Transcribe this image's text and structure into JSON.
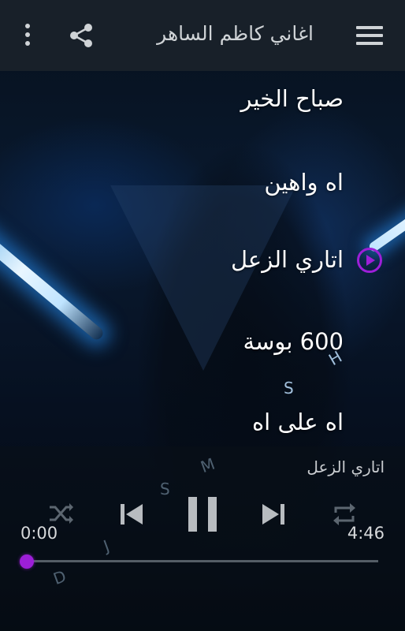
{
  "app_bar": {
    "title": "اغاني كاظم الساهر",
    "icons": [
      "menu-icon",
      "share-icon",
      "more-vert-icon"
    ]
  },
  "background": {
    "overlay_letters": [
      "H",
      "S",
      "M",
      "S",
      "J",
      "D"
    ]
  },
  "songs": [
    {
      "title": "صباح الخير",
      "playing": false
    },
    {
      "title": "اه واهين",
      "playing": false
    },
    {
      "title": "اتاري الزعل",
      "playing": true
    },
    {
      "title": "600 بوسة",
      "playing": false
    },
    {
      "title": "اه على اه",
      "playing": false
    }
  ],
  "player": {
    "now_playing": "اتاري الزعل",
    "elapsed": "0:00",
    "duration": "4:46",
    "progress_fraction": 0.0,
    "state": "playing",
    "controls": [
      "shuffle-icon",
      "previous-icon",
      "pause-icon",
      "next-icon",
      "repeat-icon"
    ]
  },
  "colors": {
    "app_bar_bg": "#19212a",
    "accent": "#9d1fd8",
    "icon_gray": "#cfd3d6"
  }
}
